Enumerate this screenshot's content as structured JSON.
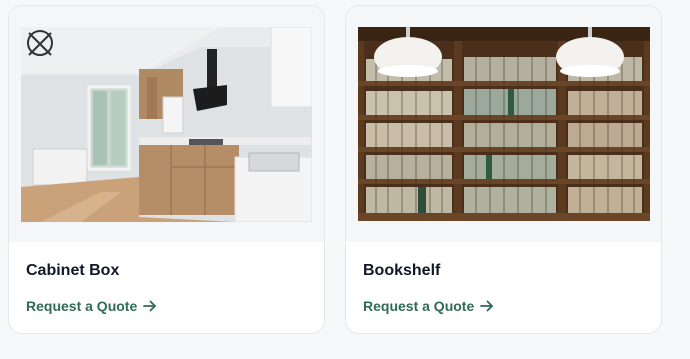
{
  "cards": [
    {
      "title": "Cabinet Box",
      "link_label": "Request a Quote",
      "image_subject": "modern kitchen with wooden cabinets",
      "icon": "arrow-right-icon"
    },
    {
      "title": "Bookshelf",
      "link_label": "Request a Quote",
      "image_subject": "wooden bookshelf filled with books",
      "icon": "arrow-right-icon"
    }
  ],
  "colors": {
    "accent": "#2f6b58",
    "title": "#111827",
    "card_border": "#e5e7eb",
    "page_background": "#f7f8fa"
  }
}
